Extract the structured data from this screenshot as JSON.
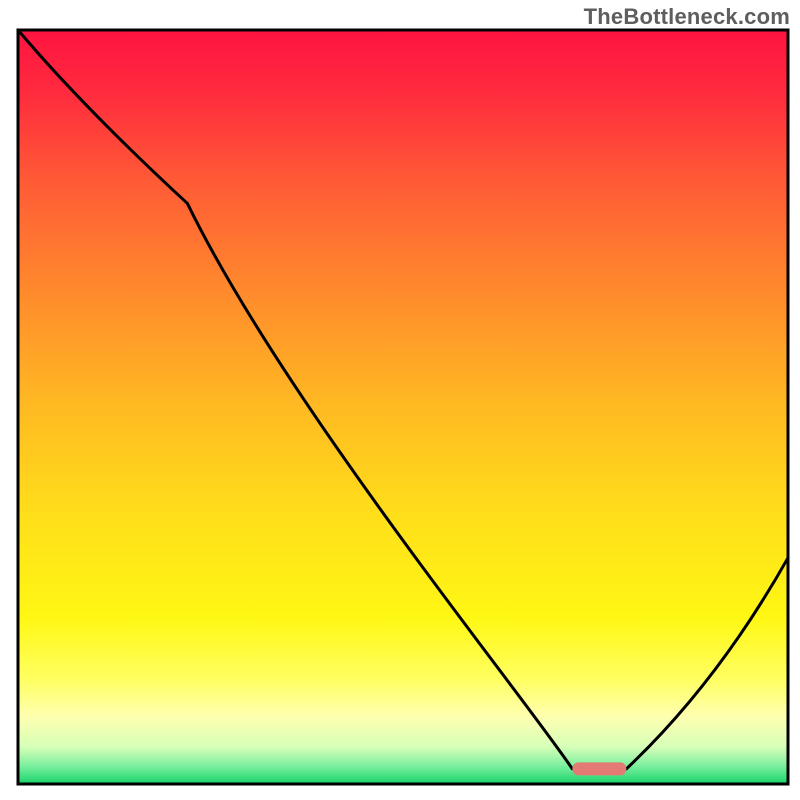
{
  "watermark": "TheBottleneck.com",
  "chart_data": {
    "type": "line",
    "title": "",
    "xlabel": "",
    "ylabel": "",
    "xlim": [
      0,
      100
    ],
    "ylim": [
      0,
      100
    ],
    "series": [
      {
        "name": "bottleneck-curve",
        "x": [
          0,
          22,
          72,
          79,
          100
        ],
        "y": [
          100,
          77,
          2,
          2,
          30
        ]
      }
    ],
    "marker": {
      "name": "target-range",
      "x_start": 72,
      "x_end": 79,
      "y": 2,
      "color": "#e37a74"
    },
    "background_gradient": {
      "stops": [
        {
          "pos": 0.0,
          "color": "#ff1440"
        },
        {
          "pos": 0.08,
          "color": "#ff2a3e"
        },
        {
          "pos": 0.2,
          "color": "#ff5a36"
        },
        {
          "pos": 0.35,
          "color": "#ff8b2c"
        },
        {
          "pos": 0.5,
          "color": "#ffba22"
        },
        {
          "pos": 0.65,
          "color": "#ffe01a"
        },
        {
          "pos": 0.78,
          "color": "#fff714"
        },
        {
          "pos": 0.86,
          "color": "#ffff60"
        },
        {
          "pos": 0.91,
          "color": "#ffffb0"
        },
        {
          "pos": 0.95,
          "color": "#d8ffb8"
        },
        {
          "pos": 0.975,
          "color": "#80f0a0"
        },
        {
          "pos": 1.0,
          "color": "#17d36b"
        }
      ]
    },
    "axes": {
      "visible": false
    },
    "frame": {
      "visible": true,
      "color": "#000000",
      "width": 3
    }
  }
}
